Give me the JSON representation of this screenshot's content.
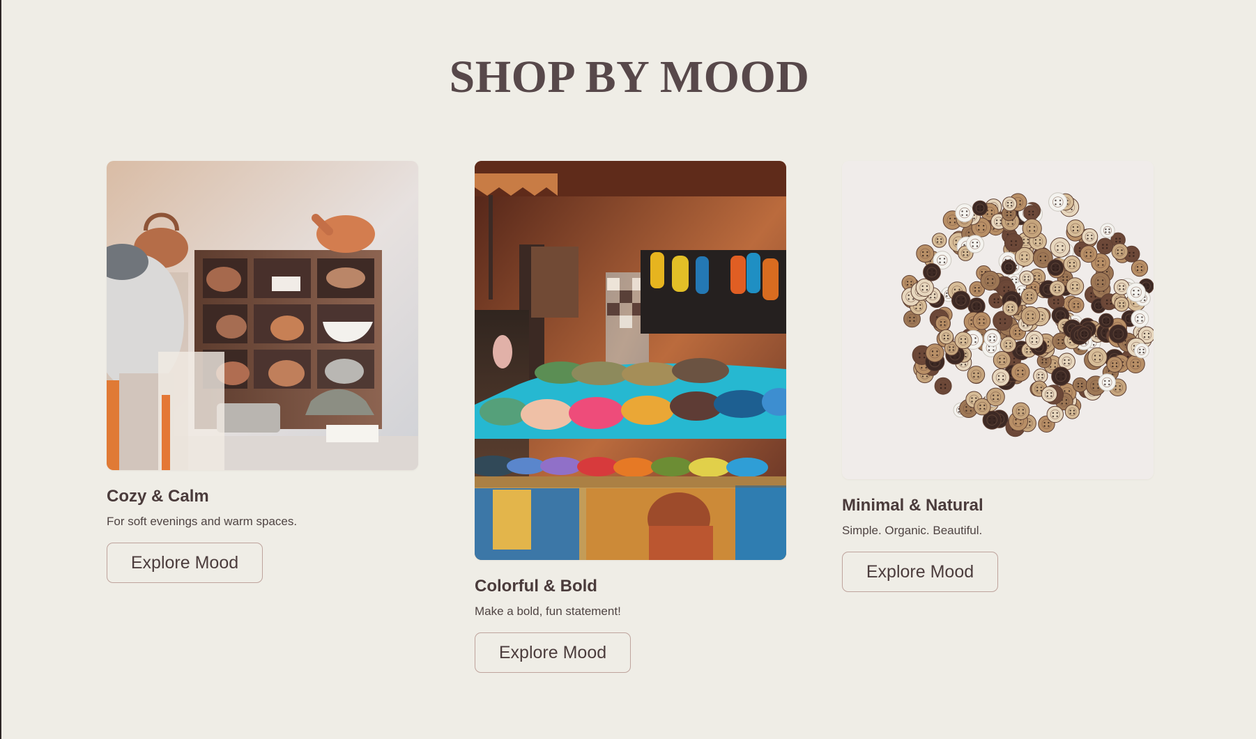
{
  "section": {
    "title": "SHOP BY MOOD"
  },
  "cards": [
    {
      "image_subject": "tea-shelf-image",
      "title": "Cozy & Calm",
      "description": "For soft evenings and warm spaces.",
      "button_label": "Explore Mood"
    },
    {
      "image_subject": "spice-market-image",
      "title": "Colorful & Bold",
      "description": "Make a bold, fun statement!",
      "button_label": "Explore Mood"
    },
    {
      "image_subject": "wooden-buttons-image",
      "title": "Minimal & Natural",
      "description": "Simple. Organic. Beautiful.",
      "button_label": "Explore Mood"
    }
  ],
  "colors": {
    "background": "#efede6",
    "title": "#57484a",
    "text": "#4a3b3b",
    "button_border": "#bea39c"
  }
}
